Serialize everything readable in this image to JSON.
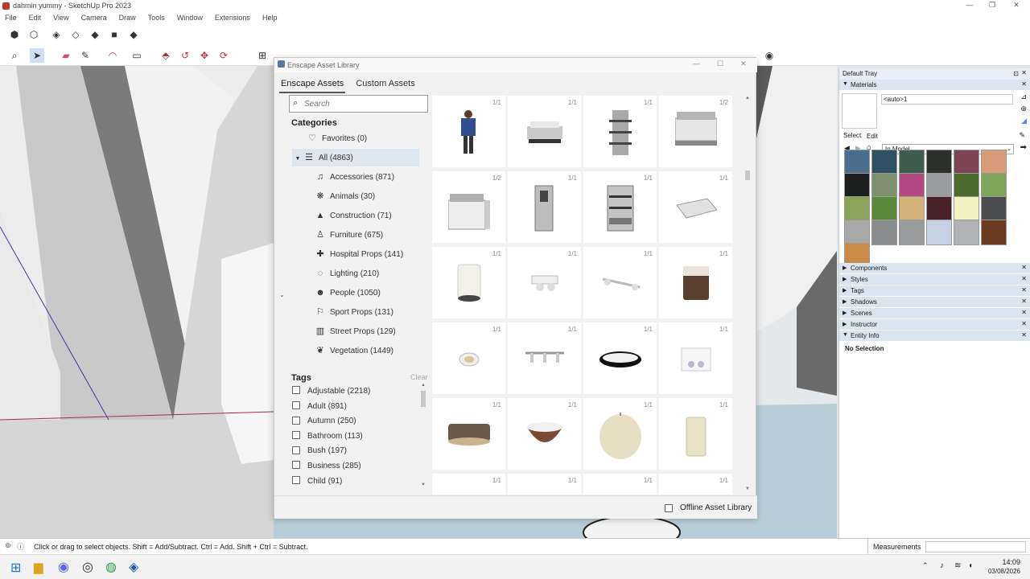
{
  "window": {
    "title": "dahmin yummy - SketchUp Pro 2023"
  },
  "menubar": [
    "File",
    "Edit",
    "View",
    "Camera",
    "Draw",
    "Tools",
    "Window",
    "Extensions",
    "Help"
  ],
  "dialog": {
    "title": "Enscape Asset Library",
    "tabs": [
      "Enscape Assets",
      "Custom Assets"
    ],
    "search_placeholder": "Search",
    "categories_heading": "Categories",
    "favorites": "Favorites (0)",
    "all": "All (4863)",
    "categories": [
      {
        "label": "Accessories (871)",
        "icon": "accessories-icon",
        "glyph": "♫"
      },
      {
        "label": "Animals (30)",
        "icon": "paw-icon",
        "glyph": "❋"
      },
      {
        "label": "Construction (71)",
        "icon": "construction-icon",
        "glyph": "▲"
      },
      {
        "label": "Furniture (675)",
        "icon": "chair-icon",
        "glyph": "♙"
      },
      {
        "label": "Hospital Props (141)",
        "icon": "hospital-icon",
        "glyph": "✚"
      },
      {
        "label": "Lighting (210)",
        "icon": "bulb-icon",
        "glyph": "◌"
      },
      {
        "label": "People (1050)",
        "icon": "people-icon",
        "glyph": "☻"
      },
      {
        "label": "Sport Props (131)",
        "icon": "sport-icon",
        "glyph": "⚐"
      },
      {
        "label": "Street Props (129)",
        "icon": "street-icon",
        "glyph": "▥"
      },
      {
        "label": "Vegetation (1449)",
        "icon": "leaf-icon",
        "glyph": "❦"
      }
    ],
    "tags_heading": "Tags",
    "clear": "Clear",
    "tags": [
      "Adjustable (2218)",
      "Adult (891)",
      "Autumn (250)",
      "Bathroom (113)",
      "Bush (197)",
      "Business (285)",
      "Child (91)"
    ],
    "assets": [
      {
        "count": "1/1",
        "kind": "person"
      },
      {
        "count": "1/1",
        "kind": "chafing"
      },
      {
        "count": "1/1",
        "kind": "shelf"
      },
      {
        "count": "1/2",
        "kind": "counter"
      },
      {
        "count": "1/2",
        "kind": "counter2"
      },
      {
        "count": "1/1",
        "kind": "cabinet"
      },
      {
        "count": "1/1",
        "kind": "shelf2"
      },
      {
        "count": "1/1",
        "kind": "panel"
      },
      {
        "count": "1/1",
        "kind": "cyl-white"
      },
      {
        "count": "1/1",
        "kind": "spots"
      },
      {
        "count": "1/1",
        "kind": "rail"
      },
      {
        "count": "1/1",
        "kind": "cyl-brown"
      },
      {
        "count": "1/1",
        "kind": "disc"
      },
      {
        "count": "1/1",
        "kind": "track"
      },
      {
        "count": "1/1",
        "kind": "ring"
      },
      {
        "count": "1/1",
        "kind": "box"
      },
      {
        "count": "1/1",
        "kind": "drum"
      },
      {
        "count": "1/1",
        "kind": "bowl"
      },
      {
        "count": "1/1",
        "kind": "lantern"
      },
      {
        "count": "1/1",
        "kind": "cylinder"
      },
      {
        "count": "1/1",
        "kind": "blank"
      },
      {
        "count": "1/1",
        "kind": "blank"
      },
      {
        "count": "1/1",
        "kind": "blank"
      },
      {
        "count": "1/1",
        "kind": "blank"
      }
    ],
    "offline_label": "Offline Asset Library"
  },
  "tray": {
    "title": "Default Tray",
    "materials": "Materials",
    "material_name": "<auto>1",
    "select_tab": "Select",
    "edit_tab": "Edit",
    "collection": "In Model",
    "swatches": [
      "#4a6d8c",
      "#2f5063",
      "#3f5b4e",
      "#2c2f2a",
      "#7e4455",
      "#d99a7a",
      "#1e1f1f",
      "#7d8f6e",
      "#b04a80",
      "#9a9c9e",
      "#4c6b2c",
      "#7fa55b",
      "#8aa25a",
      "#5d8a3a",
      "#d4b27a",
      "#4a2228",
      "#f2f2c0",
      "#4a4c4e",
      "#a8a8a8",
      "#8a8c8e",
      "#999b9d",
      "#c5d0e3",
      "#b0b2b4",
      "#6a3a20",
      "#c98a4a"
    ],
    "sections": [
      "Components",
      "Styles",
      "Tags",
      "Shadows",
      "Scenes",
      "Instructor",
      "Entity Info"
    ],
    "entity_info": "No Selection"
  },
  "status": {
    "hint": "Click or drag to select objects. Shift = Add/Subtract. Ctrl = Add. Shift + Ctrl = Subtract.",
    "measurements": "Measurements"
  },
  "taskbar": {
    "time": "14:09",
    "date": "03/08/2026"
  }
}
